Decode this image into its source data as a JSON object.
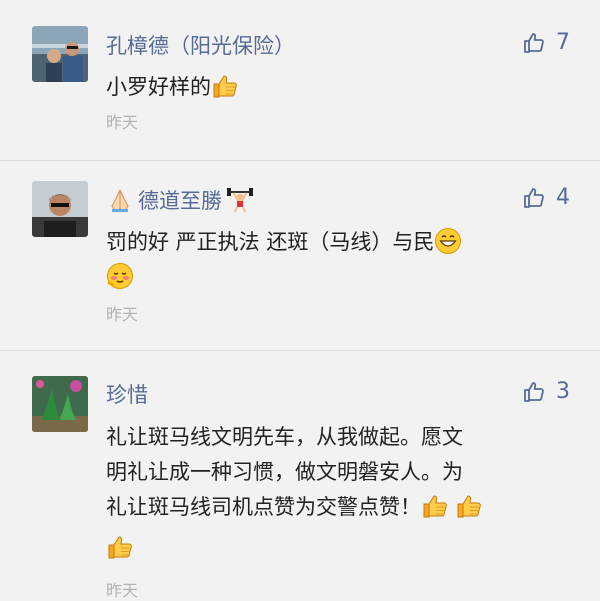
{
  "comments": [
    {
      "name": "孔樟德（阳光保险）",
      "likes": "7",
      "text": "小罗好样的",
      "time": "昨天"
    },
    {
      "name": "德道至勝",
      "likes": "4",
      "text": "罚的好 严正执法 还斑（马线）与民",
      "time": "昨天"
    },
    {
      "name": "珍惜",
      "likes": "3",
      "text_lines": [
        "礼让斑马线文明先车，从我做起。愿文",
        "明礼让成一种习惯，做文明磐安人。为",
        "礼让斑马线司机点赞为交警点赞！"
      ],
      "time": "昨天"
    }
  ],
  "colors": {
    "name": "#576b95",
    "text": "#222222",
    "time": "#b2b2b2",
    "background": "#f2f2f2"
  },
  "icons": [
    "thumbs-up-outline-icon",
    "thumbs-up-emoji-icon",
    "praying-hands-emoji-icon",
    "weightlifter-emoji-icon",
    "grinning-emoji-icon",
    "blushing-emoji-icon"
  ]
}
